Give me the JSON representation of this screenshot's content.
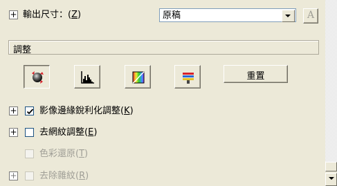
{
  "output_size": {
    "expand_symbol": "+",
    "label": "輸出尺寸：",
    "accelerator": "Z",
    "selected_value": "原稿",
    "aux_button_glyph": "A"
  },
  "adjustments": {
    "section_title": "調整",
    "tool_icons": [
      "exposure-dial-icon",
      "histogram-icon",
      "tone-curve-icon",
      "color-palette-icon"
    ],
    "reset_label": "重置"
  },
  "options": [
    {
      "expand": "+",
      "checked": true,
      "enabled": true,
      "label": "影像邊緣銳利化調整",
      "accelerator": "K"
    },
    {
      "expand": "+",
      "checked": false,
      "enabled": true,
      "label": "去網紋調整",
      "accelerator": "E"
    },
    {
      "expand": "",
      "checked": false,
      "enabled": false,
      "label": "色彩還原",
      "accelerator": "T"
    },
    {
      "expand": "+",
      "checked": false,
      "enabled": false,
      "label": "去除雜紋",
      "accelerator": "R"
    }
  ],
  "colors": {
    "panel_bg": "#ece9d8",
    "accent_red": "#d8202a",
    "disabled_text": "#a09f97"
  }
}
